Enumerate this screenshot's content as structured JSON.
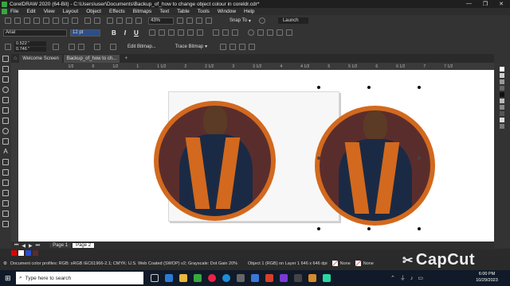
{
  "window": {
    "title": "CorelDRAW 2020 (64-Bit) - C:\\Users\\user\\Documents\\Backup_of_how to change object colour in coreldr.cdr*"
  },
  "menu": {
    "items": [
      "File",
      "Edit",
      "View",
      "Layout",
      "Object",
      "Effects",
      "Bitmaps",
      "Text",
      "Table",
      "Tools",
      "Window",
      "Help"
    ]
  },
  "toolbar": {
    "zoom": "43%",
    "snap_to": "Snap To",
    "launch": "Launch"
  },
  "properties": {
    "font_name": "Arial",
    "font_size": "12 pt",
    "width_value": "0.522 \"",
    "height_value": "0.746 \"",
    "edit_bitmap": "Edit Bitmap...",
    "trace_bitmap": "Trace Bitmap"
  },
  "doc_tabs": {
    "welcome": "Welcome Screen",
    "document": "Backup_of_how to ch..."
  },
  "ruler": {
    "ticks": [
      "1/2",
      "0",
      "1/2",
      "1",
      "1 1/2",
      "2",
      "2 1/2",
      "3",
      "3 1/2",
      "4",
      "4 1/2",
      "5",
      "5 1/2",
      "6",
      "6 1/2",
      "7",
      "7 1/2"
    ]
  },
  "page_nav": {
    "page1": "Page 1",
    "page2": "Page 2"
  },
  "status": {
    "profiles": "Document color profiles: RGB: sRGB IEC61966-2.1; CMYK: U.S. Web Coated (SWOP) v2; Grayscale: Dot Gain 20%",
    "object_info": "Object 1 (RGB) on Layer 1 646 x 646 dpi",
    "fill": "None",
    "outline": "None"
  },
  "taskbar": {
    "search_placeholder": "Type here to search",
    "time": "6:00 PM",
    "date": "10/29/2023"
  },
  "watermark": "CapCut",
  "colors": {
    "accent_orange": "#d2691e",
    "disc_dark": "#5a2d2d",
    "app_green": "#3aa640"
  }
}
